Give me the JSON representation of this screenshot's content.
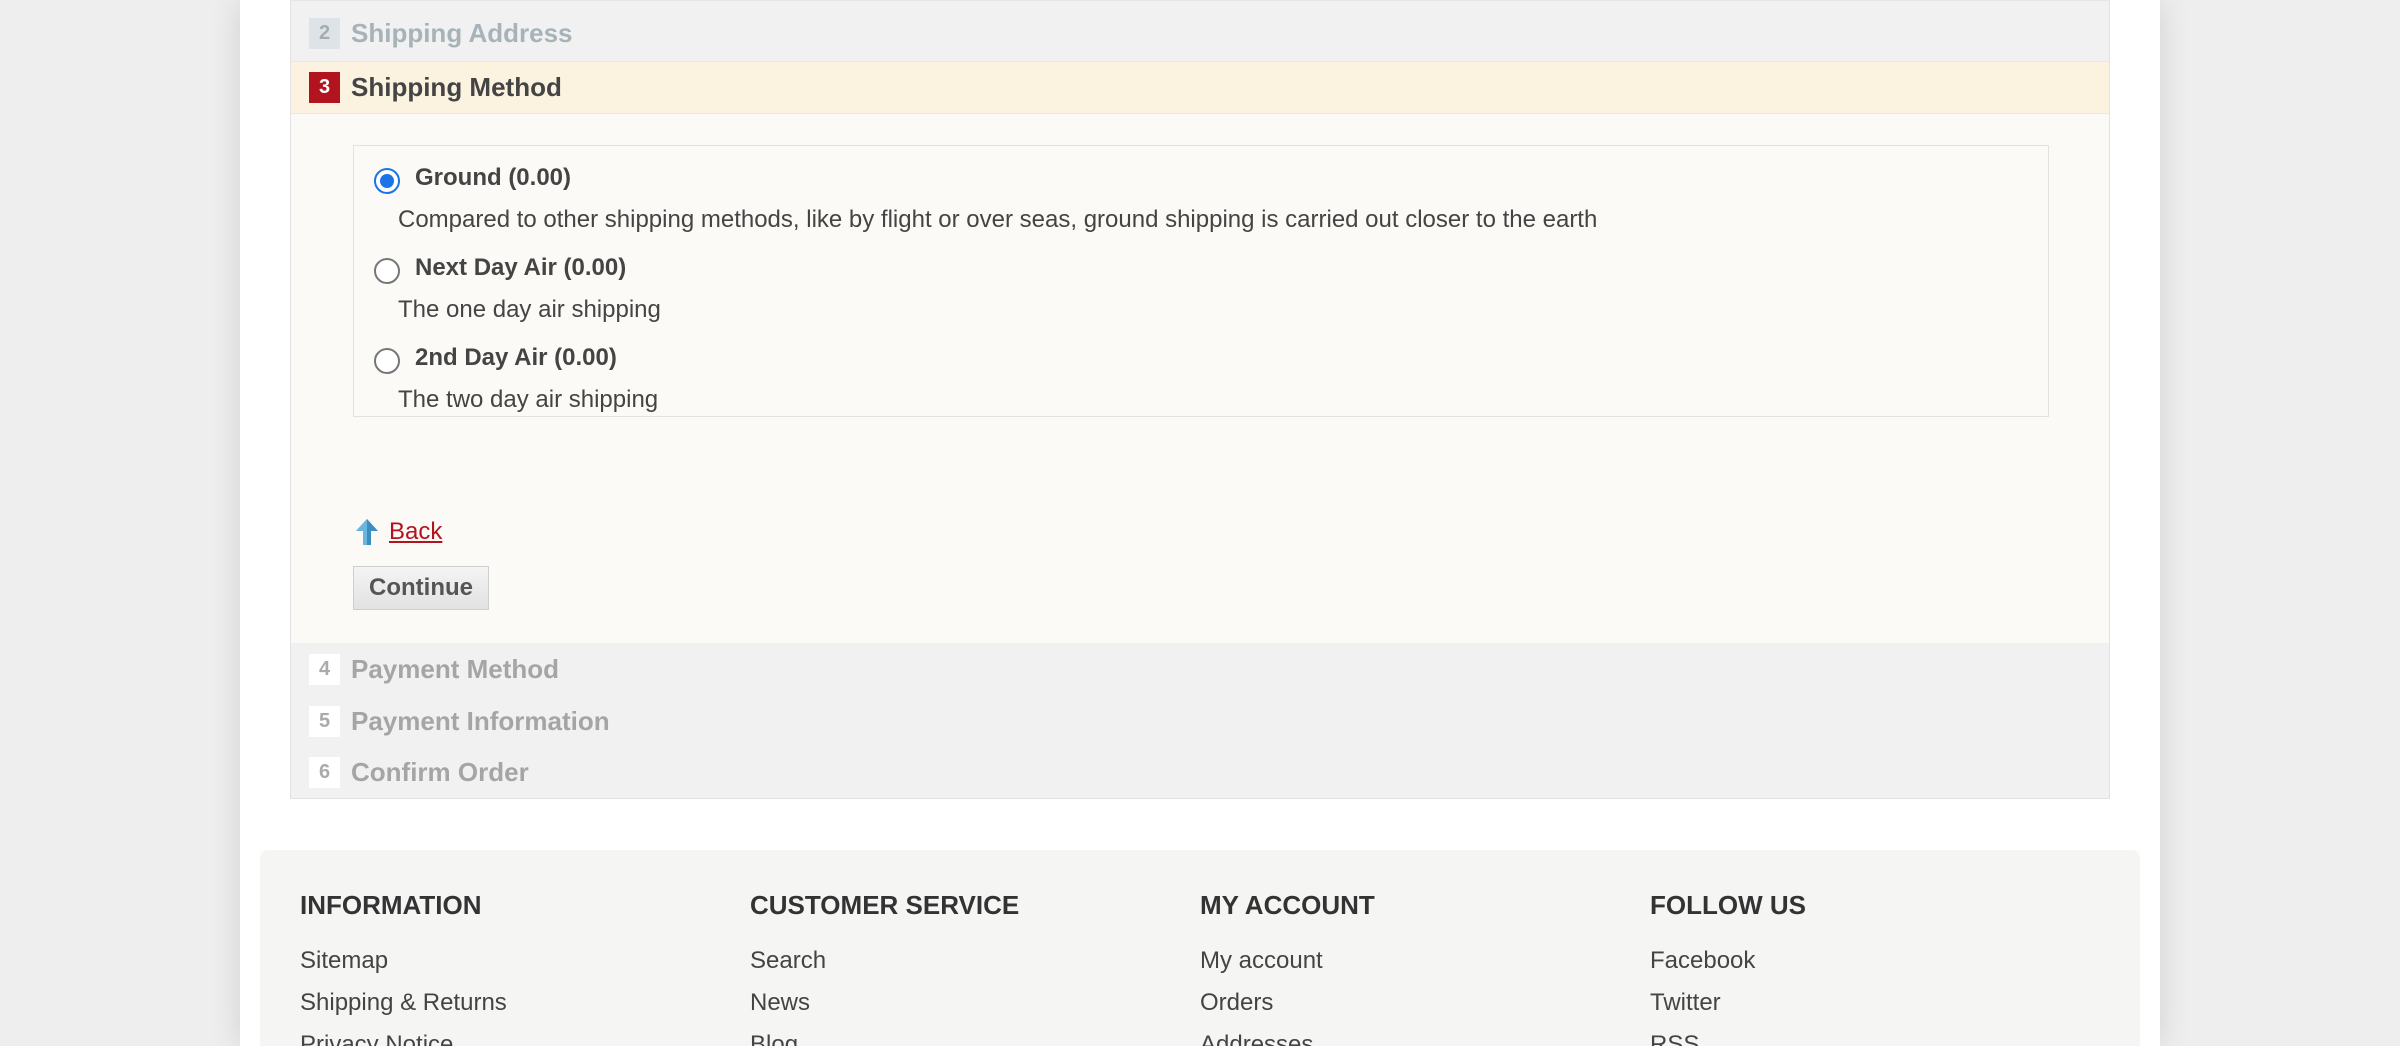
{
  "checkout": {
    "steps": [
      {
        "num": "2",
        "title": "Shipping Address"
      },
      {
        "num": "3",
        "title": "Shipping Method"
      },
      {
        "num": "4",
        "title": "Payment Method"
      },
      {
        "num": "5",
        "title": "Payment Information"
      },
      {
        "num": "6",
        "title": "Confirm Order"
      }
    ],
    "shipping_methods": [
      {
        "name": "Ground (0.00)",
        "description": "Compared to other shipping methods, like by flight or over seas, ground shipping is carried out closer to the earth",
        "selected": true
      },
      {
        "name": "Next Day Air (0.00)",
        "description": "The one day air shipping",
        "selected": false
      },
      {
        "name": "2nd Day Air (0.00)",
        "description": "The two day air shipping",
        "selected": false
      }
    ],
    "back_label": "Back",
    "continue_label": "Continue"
  },
  "footer": {
    "columns": [
      {
        "heading": "INFORMATION",
        "links": [
          "Sitemap",
          "Shipping & Returns",
          "Privacy Notice"
        ]
      },
      {
        "heading": "CUSTOMER SERVICE",
        "links": [
          "Search",
          "News",
          "Blog"
        ]
      },
      {
        "heading": "MY ACCOUNT",
        "links": [
          "My account",
          "Orders",
          "Addresses"
        ]
      },
      {
        "heading": "FOLLOW US",
        "links": [
          "Facebook",
          "Twitter",
          "RSS"
        ]
      }
    ]
  },
  "colors": {
    "accent": "#b2141f",
    "active_step_bg": "#fbf2e0",
    "radio_checked": "#1a73e8"
  }
}
